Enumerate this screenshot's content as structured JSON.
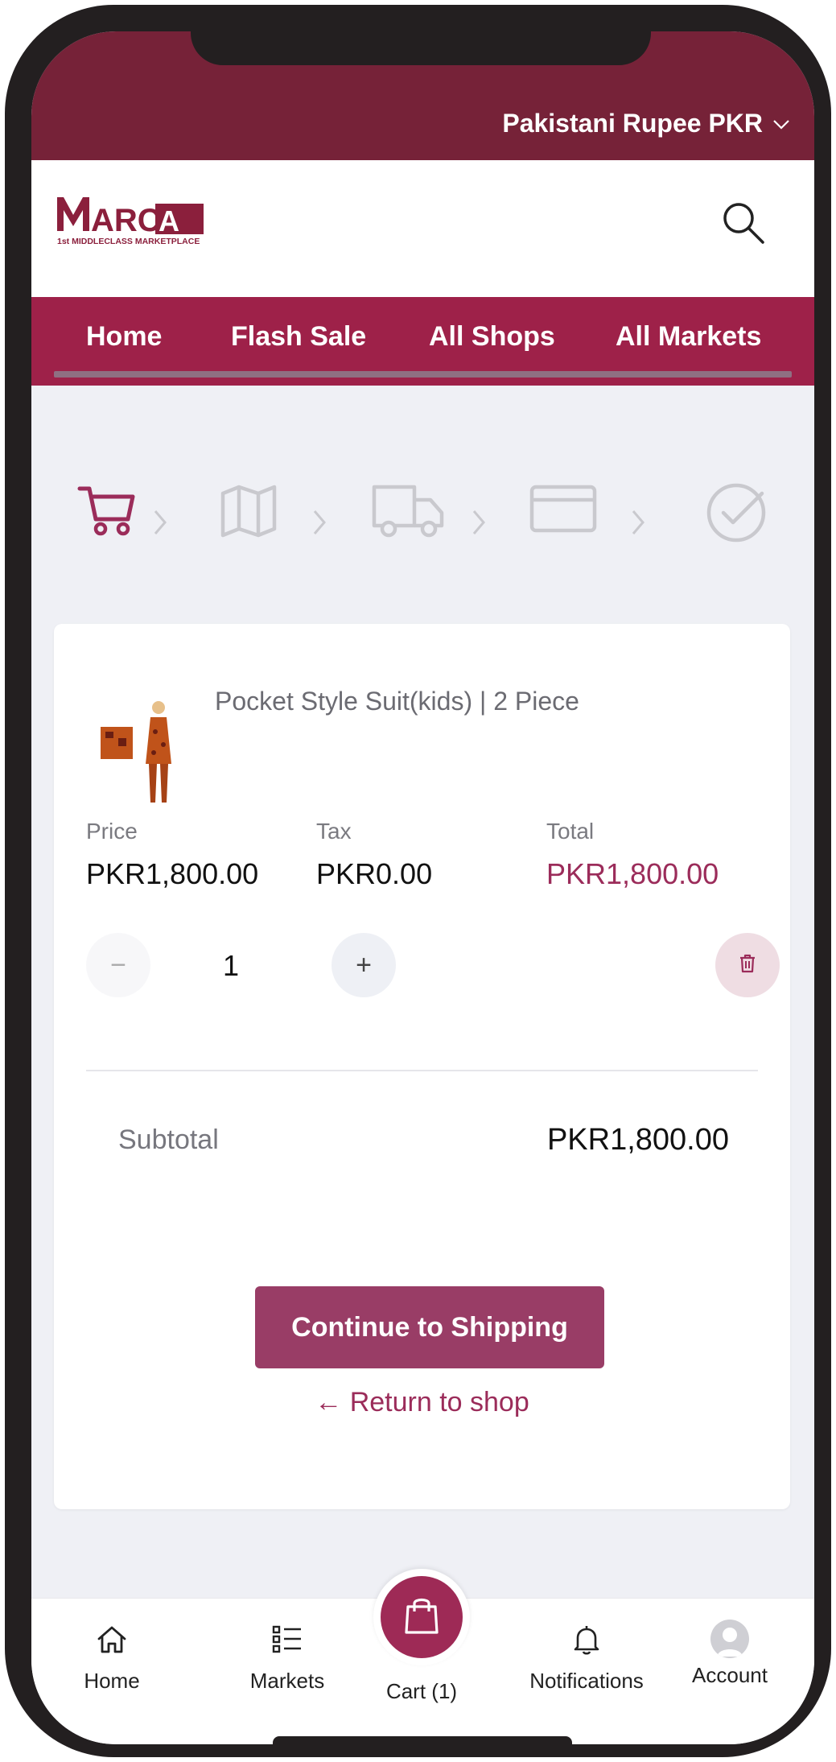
{
  "topbar": {
    "currency_label": "Pakistani Rupee PKR"
  },
  "header": {
    "logo_text": "MARCA",
    "logo_tagline": "1st MIDDLECLASS MARKETPLACE"
  },
  "nav": {
    "items": [
      "Home",
      "Flash Sale",
      "All Shops",
      "All Markets"
    ]
  },
  "checkout_steps": [
    {
      "icon": "cart-icon",
      "active": true
    },
    {
      "icon": "map-icon",
      "active": false
    },
    {
      "icon": "truck-icon",
      "active": false
    },
    {
      "icon": "credit-card-icon",
      "active": false
    },
    {
      "icon": "check-circle-icon",
      "active": false
    }
  ],
  "cart_item": {
    "name": "Pocket Style Suit(kids) | 2 Piece",
    "price_label": "Price",
    "price": "PKR1,800.00",
    "tax_label": "Tax",
    "tax": "PKR0.00",
    "total_label": "Total",
    "total": "PKR1,800.00",
    "quantity": "1",
    "minus": "−",
    "plus": "+"
  },
  "summary": {
    "subtotal_label": "Subtotal",
    "subtotal_value": "PKR1,800.00"
  },
  "actions": {
    "continue_label": "Continue to Shipping",
    "return_label": "← Return to shop"
  },
  "bottom_nav": {
    "home": "Home",
    "markets": "Markets",
    "cart": "Cart (1)",
    "notifications": "Notifications",
    "account": "Account"
  },
  "colors": {
    "brand_dark": "#762238",
    "brand": "#9e2149",
    "accent": "#9b2c5a",
    "button": "#993d66"
  }
}
